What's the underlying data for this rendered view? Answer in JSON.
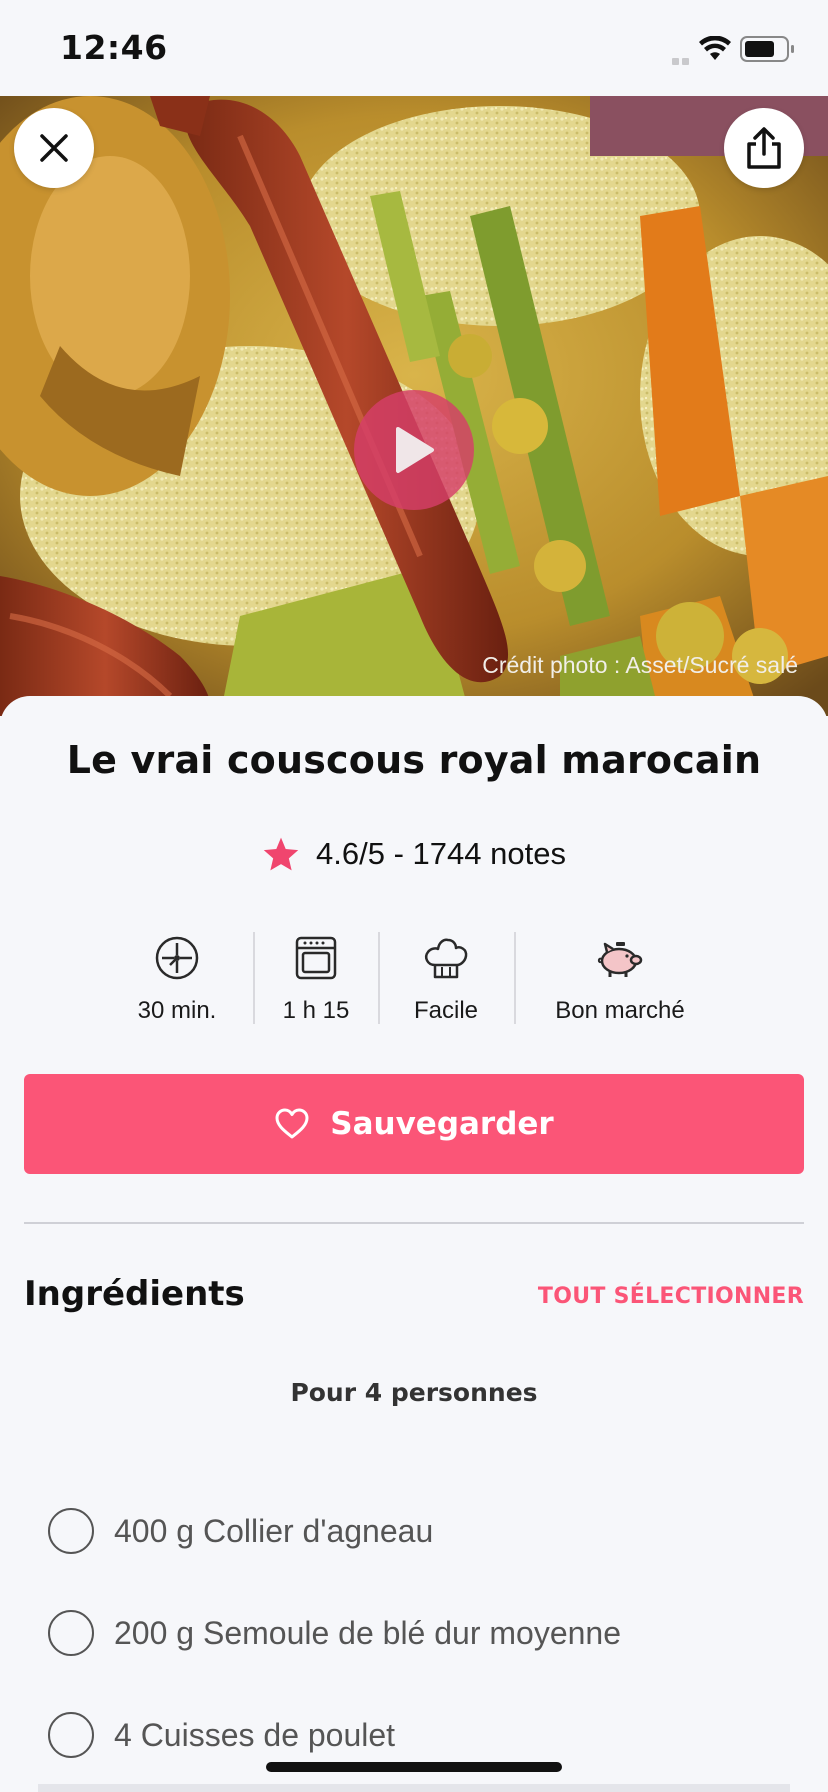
{
  "status_bar": {
    "time": "12:46"
  },
  "hero": {
    "photo_credit": "Crédit photo : Asset/Sucré salé",
    "icons": {
      "close": "close-icon",
      "share": "share-icon",
      "play": "play-icon"
    }
  },
  "recipe": {
    "title": "Le vrai couscous royal marocain",
    "rating_text": "4.6/5 - 1744 notes",
    "rating_value": 4.6,
    "info": [
      {
        "icon": "timer-icon",
        "label": "30 min."
      },
      {
        "icon": "oven-icon",
        "label": "1 h 15"
      },
      {
        "icon": "chef-hat-icon",
        "label": "Facile"
      },
      {
        "icon": "piggy-bank-icon",
        "label": "Bon marché"
      }
    ]
  },
  "actions": {
    "save_label": "Sauvegarder"
  },
  "ingredients": {
    "title": "Ingrédients",
    "select_all": "TOUT SÉLECTIONNER",
    "servings": "Pour 4 personnes",
    "items": [
      "400 g Collier d'agneau",
      "200 g Semoule de blé dur moyenne",
      "4 Cuisses de poulet"
    ]
  },
  "colors": {
    "accent": "#fb5577",
    "star": "#f0456e",
    "background": "#f6f7fa"
  }
}
